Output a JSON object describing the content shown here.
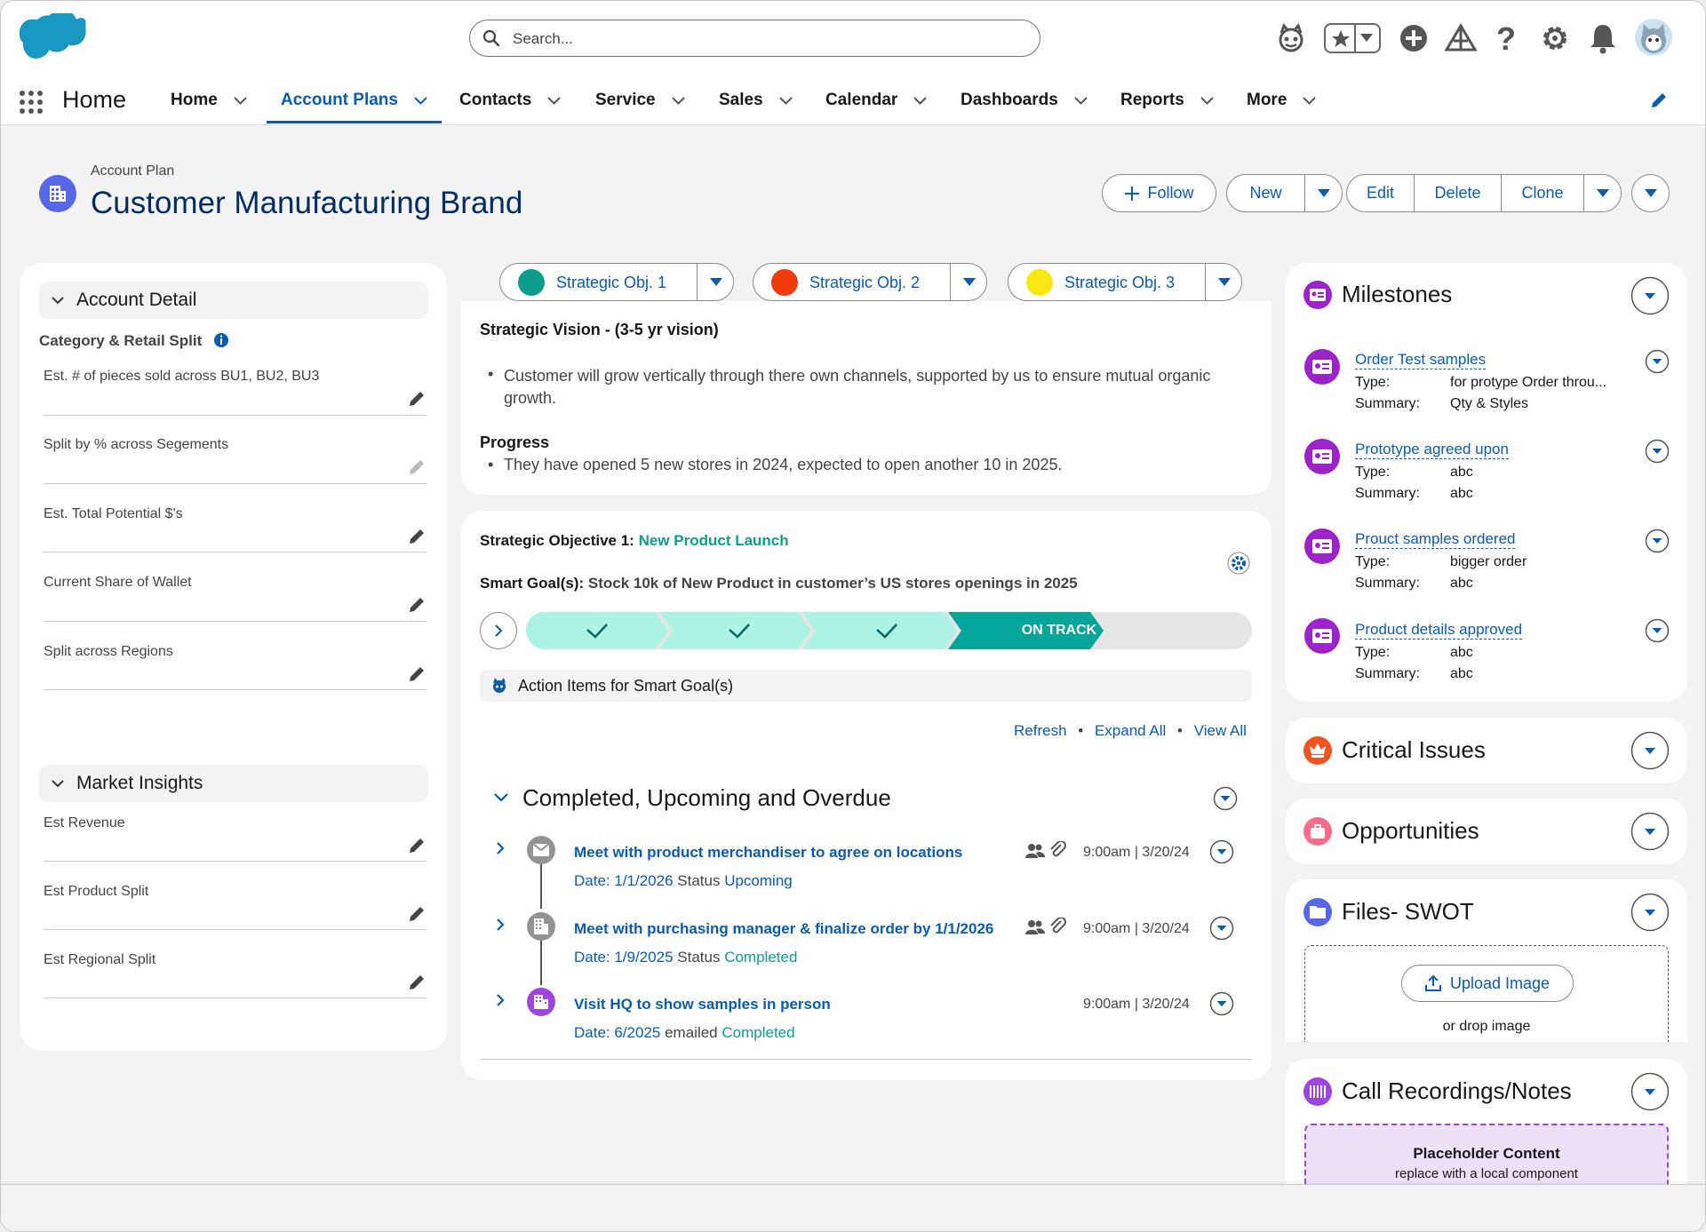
{
  "header": {
    "search_placeholder": "Search..."
  },
  "nav": {
    "app_name": "Home",
    "items": [
      {
        "label": "Home"
      },
      {
        "label": "Account Plans"
      },
      {
        "label": "Contacts"
      },
      {
        "label": "Service"
      },
      {
        "label": "Sales"
      },
      {
        "label": "Calendar"
      },
      {
        "label": "Dashboards"
      },
      {
        "label": "Reports"
      },
      {
        "label": "More"
      }
    ]
  },
  "record": {
    "object": "Account Plan",
    "title": "Customer Manufacturing Brand",
    "actions": {
      "follow": "Follow",
      "new": "New",
      "edit": "Edit",
      "delete": "Delete",
      "clone": "Clone"
    }
  },
  "detail": {
    "section1": "Account Detail",
    "subheading": "Category & Retail  Split",
    "fields": [
      "Est. # of pieces sold across  BU1, BU2, BU3",
      "Split by % across Segements",
      "Est. Total Potential $'s",
      "Current Share of Wallet",
      "Split across Regions"
    ],
    "section2": "Market Insights",
    "fields2": [
      "Est Revenue",
      "Est Product Split",
      "Est Regional Split"
    ]
  },
  "objectives": {
    "tabs": [
      {
        "label": "Strategic Obj. 1",
        "color": "#0d9d8c"
      },
      {
        "label": "Strategic Obj. 2",
        "color": "#f03b0c"
      },
      {
        "label": "Strategic Obj. 3",
        "color": "#f8e812"
      }
    ],
    "vision_title": "Strategic Vision - (3-5 yr vision)",
    "vision_text": "Customer will grow vertically through there own channels, supported by us to ensure mutual organic growth.",
    "progress_title": "Progress",
    "progress_text": "They have opened 5 new stores in 2024, expected to open another 10 in 2025."
  },
  "objective1": {
    "prefix": "Strategic Objective 1:",
    "name": "New Product  Launch",
    "goal_prefix": "Smart Goal(s):",
    "goal": "Stock 10k of New Product in customer’s US stores openings in 2025",
    "status": "ON TRACK",
    "action_items": "Action Items for Smart Goal(s)",
    "links": {
      "refresh": "Refresh",
      "expand": "Expand All",
      "view": "View All"
    },
    "timeline_heading": "Completed, Upcoming and Overdue",
    "items": [
      {
        "title": "Meet with product merchandiser to agree on  locations",
        "date": "Date: 1/1/2026",
        "status_word": "Status",
        "status": "Upcoming",
        "time": "9:00am | 3/20/24"
      },
      {
        "title": "Meet with purchasing manager & finalize order by 1/1/2026",
        "date": "Date: 1/9/2025",
        "status_word": "Status",
        "status": "Completed",
        "time": "9:00am | 3/20/24"
      },
      {
        "title": "Visit HQ to show samples in person",
        "date": "Date: 6/2025",
        "status_word": "emailed",
        "status": "Completed",
        "time": "9:00am | 3/20/24"
      }
    ]
  },
  "milestones": {
    "heading": "Milestones",
    "type_label": "Type:",
    "summary_label": "Summary:",
    "items": [
      {
        "title": "Order Test samples",
        "type": "for protype Order throu...",
        "summary": "Qty & Styles"
      },
      {
        "title": "Prototype agreed upon",
        "type": "abc",
        "summary": "abc"
      },
      {
        "title": "Prouct samples ordered",
        "type": "bigger order",
        "summary": "abc"
      },
      {
        "title": "Product details approved",
        "type": "abc",
        "summary": "abc"
      }
    ]
  },
  "right": {
    "critical": "Critical Issues",
    "opps": "Opportunities",
    "files": "Files- SWOT",
    "upload": "Upload Image",
    "drop": "or drop image",
    "calls": "Call Recordings/Notes",
    "placeholder_title": "Placeholder Content",
    "placeholder_sub": "replace with a local component"
  }
}
